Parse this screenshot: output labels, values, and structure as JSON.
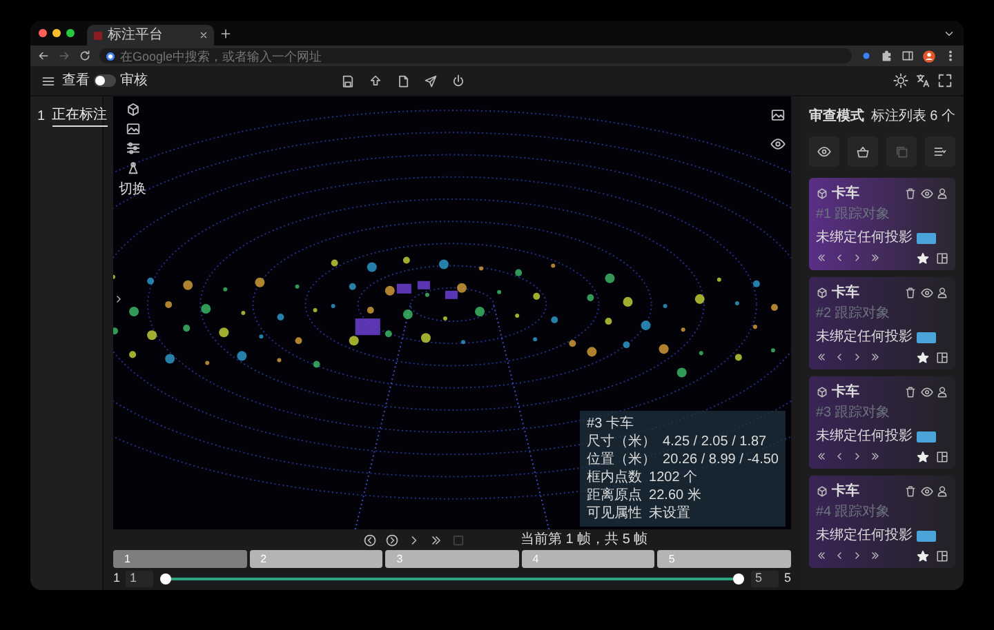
{
  "browser": {
    "tab_title": "标注平台",
    "address_placeholder": "在Google中搜索，或者输入一个网址"
  },
  "header": {
    "view_label": "查看",
    "review_label": "审核",
    "review_on": false
  },
  "sidebar": {
    "items": [
      {
        "index": "1",
        "label": "正在标注",
        "selected": true
      }
    ]
  },
  "canvas": {
    "tool_label": "切换",
    "info": {
      "title": "#3 卡车",
      "rows": [
        {
          "label": "尺寸（米）",
          "value": "4.25 / 2.05 / 1.87"
        },
        {
          "label": "位置（米）",
          "value": "20.26 / 8.99 / -4.50"
        },
        {
          "label": "框内点数",
          "value": "1202 个"
        },
        {
          "label": "距离原点",
          "value": "22.60 米"
        },
        {
          "label": "可见属性",
          "value": "未设置"
        }
      ]
    }
  },
  "panel": {
    "title": "审查模式",
    "list_label": "标注列表",
    "count": "6 个",
    "objects": [
      {
        "name": "卡车",
        "id": "#1",
        "type": "跟踪对象",
        "projection": "未绑定任何投影",
        "selected": true
      },
      {
        "name": "卡车",
        "id": "#2",
        "type": "跟踪对象",
        "projection": "未绑定任何投影",
        "selected": false
      },
      {
        "name": "卡车",
        "id": "#3",
        "type": "跟踪对象",
        "projection": "未绑定任何投影",
        "selected": false
      },
      {
        "name": "卡车",
        "id": "#4",
        "type": "跟踪对象",
        "projection": "未绑定任何投影",
        "selected": false
      }
    ]
  },
  "timeline": {
    "status": "当前第 1 帧，共 5 帧",
    "frames": [
      {
        "label": "1",
        "selected": true
      },
      {
        "label": "2",
        "selected": false
      },
      {
        "label": "3",
        "selected": false
      },
      {
        "label": "4",
        "selected": false
      },
      {
        "label": "5",
        "selected": false
      }
    ],
    "min_label": "1",
    "start_value": "1",
    "end_value": "5",
    "max_label": "5",
    "start_handle": {
      "level": 0
    },
    "end_handle": {
      "level": 1
    }
  }
}
